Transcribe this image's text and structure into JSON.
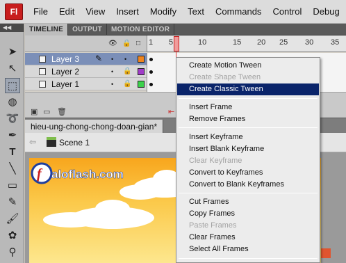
{
  "app": {
    "icon_label": "Fl"
  },
  "menubar": [
    "File",
    "Edit",
    "View",
    "Insert",
    "Modify",
    "Text",
    "Commands",
    "Control",
    "Debug",
    "W"
  ],
  "panel_tabs": [
    "TIMELINE",
    "OUTPUT",
    "MOTION EDITOR"
  ],
  "timeline": {
    "ruler_ticks": [
      "1",
      "5",
      "10",
      "15",
      "20",
      "25",
      "30",
      "35"
    ],
    "current_frame": 5,
    "layers": [
      {
        "name": "Layer 3",
        "color": "#f0851e",
        "selected": true
      },
      {
        "name": "Layer 2",
        "color": "#a03cc8",
        "selected": false
      },
      {
        "name": "Layer 1",
        "color": "#3bd14b",
        "selected": false
      }
    ]
  },
  "document": {
    "tab": "hieu-ung-chong-chong-doan-gian*",
    "close": "×",
    "scene": "Scene 1"
  },
  "watermark": {
    "text": "aloflash.com"
  },
  "context_menu": {
    "groups": [
      [
        {
          "label": "Create Motion Tween",
          "enabled": true
        },
        {
          "label": "Create Shape Tween",
          "enabled": false
        },
        {
          "label": "Create Classic Tween",
          "enabled": true,
          "highlighted": true
        }
      ],
      [
        {
          "label": "Insert Frame",
          "enabled": true
        },
        {
          "label": "Remove Frames",
          "enabled": true
        }
      ],
      [
        {
          "label": "Insert Keyframe",
          "enabled": true
        },
        {
          "label": "Insert Blank Keyframe",
          "enabled": true
        },
        {
          "label": "Clear Keyframe",
          "enabled": false
        },
        {
          "label": "Convert to Keyframes",
          "enabled": true
        },
        {
          "label": "Convert to Blank Keyframes",
          "enabled": true
        }
      ],
      [
        {
          "label": "Cut Frames",
          "enabled": true
        },
        {
          "label": "Copy Frames",
          "enabled": true
        },
        {
          "label": "Paste Frames",
          "enabled": false
        },
        {
          "label": "Clear Frames",
          "enabled": true
        },
        {
          "label": "Select All Frames",
          "enabled": true
        }
      ]
    ]
  }
}
